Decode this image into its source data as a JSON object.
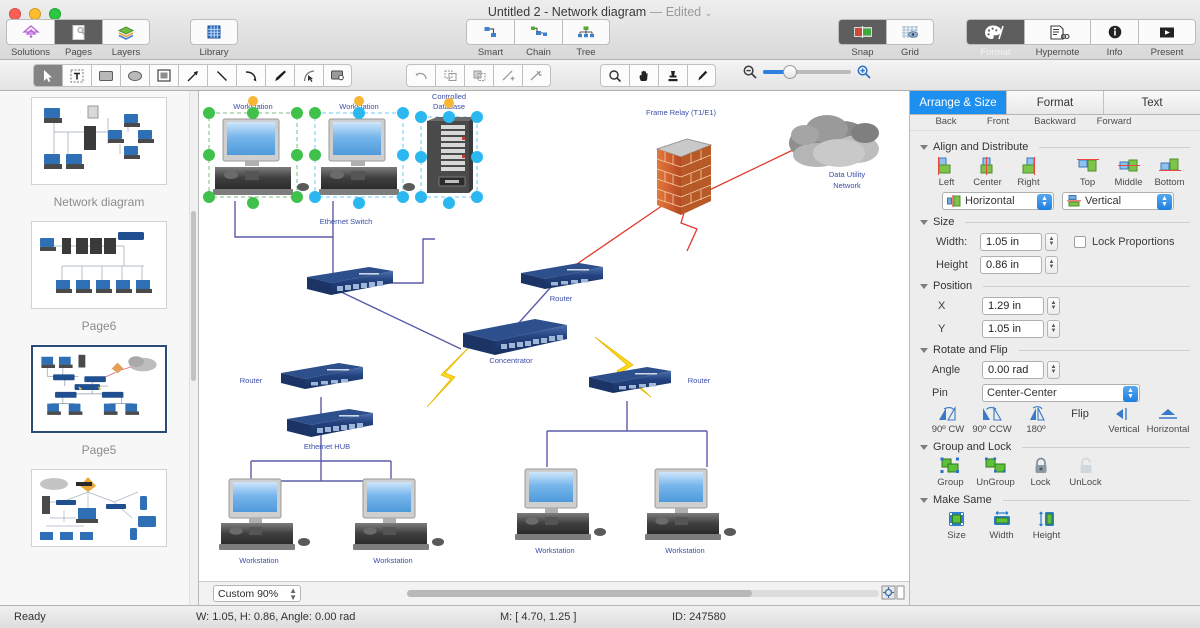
{
  "window": {
    "title_main": "Untitled 2 - Network diagram",
    "title_dash": "—",
    "title_edited": "Edited",
    "chevron": "⌄"
  },
  "toolbar": {
    "left_group": [
      {
        "label": "Solutions",
        "icon": "solutions-icon",
        "active": false
      },
      {
        "label": "Pages",
        "icon": "pages-icon",
        "active": true
      },
      {
        "label": "Layers",
        "icon": "layers-icon",
        "active": false
      }
    ],
    "library": {
      "label": "Library",
      "icon": "library-icon"
    },
    "connector_group": [
      {
        "label": "Smart",
        "icon": "smart-connector-icon"
      },
      {
        "label": "Chain",
        "icon": "chain-connector-icon"
      },
      {
        "label": "Tree",
        "icon": "tree-connector-icon"
      }
    ],
    "snap_group": [
      {
        "label": "Snap",
        "icon": "snap-icon",
        "active": true
      },
      {
        "label": "Grid",
        "icon": "grid-icon",
        "active": false
      }
    ],
    "right_group": [
      {
        "label": "Format",
        "icon": "format-palette-icon",
        "active": true
      },
      {
        "label": "Hypernote",
        "icon": "hypernote-icon",
        "active": false
      },
      {
        "label": "Info",
        "icon": "info-icon",
        "active": false
      },
      {
        "label": "Present",
        "icon": "present-icon",
        "active": false
      }
    ]
  },
  "tools": {
    "draw": [
      "pointer-icon",
      "text-icon",
      "rectangle-icon",
      "ellipse-icon",
      "frame-icon",
      "arrow-icon",
      "line-icon",
      "curve-icon",
      "pen-icon",
      "bezier-icon",
      "callout-icon"
    ],
    "edit": [
      "undo-arc-icon",
      "union-icon",
      "subtract-icon",
      "split-icon",
      "magic-wand-icon"
    ],
    "view": [
      "zoom-icon",
      "hand-icon",
      "stamp-icon",
      "eyedropper-icon"
    ],
    "zoom_out_icon": "zoom-out-icon",
    "zoom_in_icon": "zoom-in-icon"
  },
  "sidebar": {
    "pages": [
      {
        "label": "Network diagram",
        "selected": false,
        "thumb": "thumb-network-diagram"
      },
      {
        "label": "Page6",
        "selected": false,
        "thumb": "thumb-page6"
      },
      {
        "label": "Page5",
        "selected": true,
        "thumb": "thumb-page5"
      },
      {
        "label": "",
        "selected": false,
        "thumb": "thumb-page4"
      }
    ]
  },
  "canvas": {
    "zoom_value": "Custom 90%",
    "nodes": [
      {
        "id": "ws1",
        "label": "Workstation",
        "type": "workstation",
        "selected": true,
        "handle_color": "#3fc14b"
      },
      {
        "id": "ws2",
        "label": "Workstation",
        "type": "workstation",
        "selected": true,
        "handle_color": "#2bb7f0"
      },
      {
        "id": "db1",
        "label": "Controlled\nDatabase",
        "type": "database",
        "selected": true,
        "handle_color": "#2bb7f0"
      },
      {
        "id": "sw1",
        "label": "Ethernet Switch",
        "type": "switch",
        "selected": false
      },
      {
        "id": "rt1",
        "label": "Router",
        "type": "router",
        "selected": false
      },
      {
        "id": "fr1",
        "label": "Frame Relay (T1/E1)",
        "type": "firewall-brick",
        "selected": false
      },
      {
        "id": "cl1",
        "label": "Data Utility\nNetwork",
        "type": "cloud",
        "selected": false
      },
      {
        "id": "cc1",
        "label": "Concentrator",
        "type": "concentrator",
        "selected": false
      },
      {
        "id": "rt2",
        "label": "Router",
        "type": "router",
        "selected": false
      },
      {
        "id": "hub1",
        "label": "Ethernet HUB",
        "type": "hub",
        "selected": false
      },
      {
        "id": "ws3",
        "label": "Workstation",
        "type": "workstation",
        "selected": false
      },
      {
        "id": "ws4",
        "label": "Workstation",
        "type": "workstation",
        "selected": false
      },
      {
        "id": "rt3",
        "label": "Router",
        "type": "router",
        "selected": false
      },
      {
        "id": "ws5",
        "label": "Workstation",
        "type": "workstation",
        "selected": false
      },
      {
        "id": "ws6",
        "label": "Workstation",
        "type": "workstation",
        "selected": false
      }
    ],
    "label_color": "#3b4ea8"
  },
  "inspector": {
    "tabs": [
      {
        "label": "Arrange & Size",
        "active": true
      },
      {
        "label": "Format",
        "active": false
      },
      {
        "label": "Text",
        "active": false
      }
    ],
    "order_row": [
      "Back",
      "Front",
      "Backward",
      "Forward"
    ],
    "align": {
      "title": "Align and Distribute",
      "buttons": [
        {
          "label": "Left",
          "icon": "align-left-icon"
        },
        {
          "label": "Center",
          "icon": "align-center-icon"
        },
        {
          "label": "Right",
          "icon": "align-right-icon"
        },
        {
          "label": "Top",
          "icon": "align-top-icon"
        },
        {
          "label": "Middle",
          "icon": "align-middle-icon"
        },
        {
          "label": "Bottom",
          "icon": "align-bottom-icon"
        }
      ],
      "distribute_h": "Horizontal",
      "distribute_v": "Vertical"
    },
    "size": {
      "title": "Size",
      "width_label": "Width:",
      "width_value": "1.05 in",
      "height_label": "Height",
      "height_value": "0.86 in",
      "lock_label": "Lock Proportions",
      "lock_checked": false
    },
    "position": {
      "title": "Position",
      "x_label": "X",
      "x_value": "1.29 in",
      "y_label": "Y",
      "y_value": "1.05 in"
    },
    "rotate": {
      "title": "Rotate and Flip",
      "angle_label": "Angle",
      "angle_value": "0.00 rad",
      "pin_label": "Pin",
      "pin_value": "Center-Center",
      "buttons": [
        {
          "label": "90º CW",
          "icon": "rotate-cw-icon"
        },
        {
          "label": "90º CCW",
          "icon": "rotate-ccw-icon"
        },
        {
          "label": "180º",
          "icon": "rotate-180-icon"
        }
      ],
      "flip_label": "Flip",
      "flip_buttons": [
        {
          "label": "Vertical",
          "icon": "flip-vertical-icon"
        },
        {
          "label": "Horizontal",
          "icon": "flip-horizontal-icon"
        }
      ]
    },
    "group": {
      "title": "Group and Lock",
      "buttons": [
        {
          "label": "Group",
          "icon": "group-icon"
        },
        {
          "label": "UnGroup",
          "icon": "ungroup-icon"
        },
        {
          "label": "Lock",
          "icon": "lock-icon"
        },
        {
          "label": "UnLock",
          "icon": "unlock-icon"
        }
      ]
    },
    "makesame": {
      "title": "Make Same",
      "buttons": [
        {
          "label": "Size",
          "icon": "same-size-icon"
        },
        {
          "label": "Width",
          "icon": "same-width-icon"
        },
        {
          "label": "Height",
          "icon": "same-height-icon"
        }
      ]
    }
  },
  "status": {
    "ready": "Ready",
    "dims": "W: 1.05,  H: 0.86,  Angle: 0.00 rad",
    "mouse": "M: [ 4.70, 1.25 ]",
    "id": "ID: 247580"
  }
}
